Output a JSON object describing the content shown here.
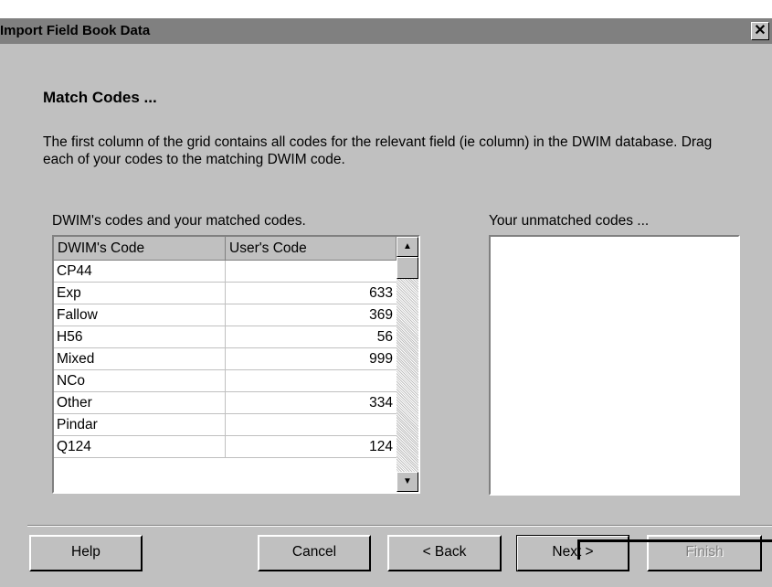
{
  "window": {
    "title": "Import Field Book Data",
    "close_icon": "close-icon"
  },
  "section": {
    "heading": "Match Codes ...",
    "description": "The first column of the grid contains all codes for the relevant field (ie column) in the DWIM database.  Drag each of your codes to the matching DWIM code."
  },
  "grid": {
    "label": "DWIM's codes and your matched codes.",
    "columns": [
      "DWIM's Code",
      "User's Code"
    ],
    "rows": [
      [
        "CP44",
        ""
      ],
      [
        "Exp",
        "633"
      ],
      [
        "Fallow",
        "369"
      ],
      [
        "H56",
        "56"
      ],
      [
        "Mixed",
        "999"
      ],
      [
        "NCo",
        ""
      ],
      [
        "Other",
        "334"
      ],
      [
        "Pindar",
        ""
      ],
      [
        "Q124",
        "124"
      ]
    ]
  },
  "unmatched": {
    "label": "Your unmatched codes ..."
  },
  "buttons": {
    "help": "Help",
    "cancel": "Cancel",
    "back": "< Back",
    "next": "Next >",
    "finish": "Finish"
  }
}
